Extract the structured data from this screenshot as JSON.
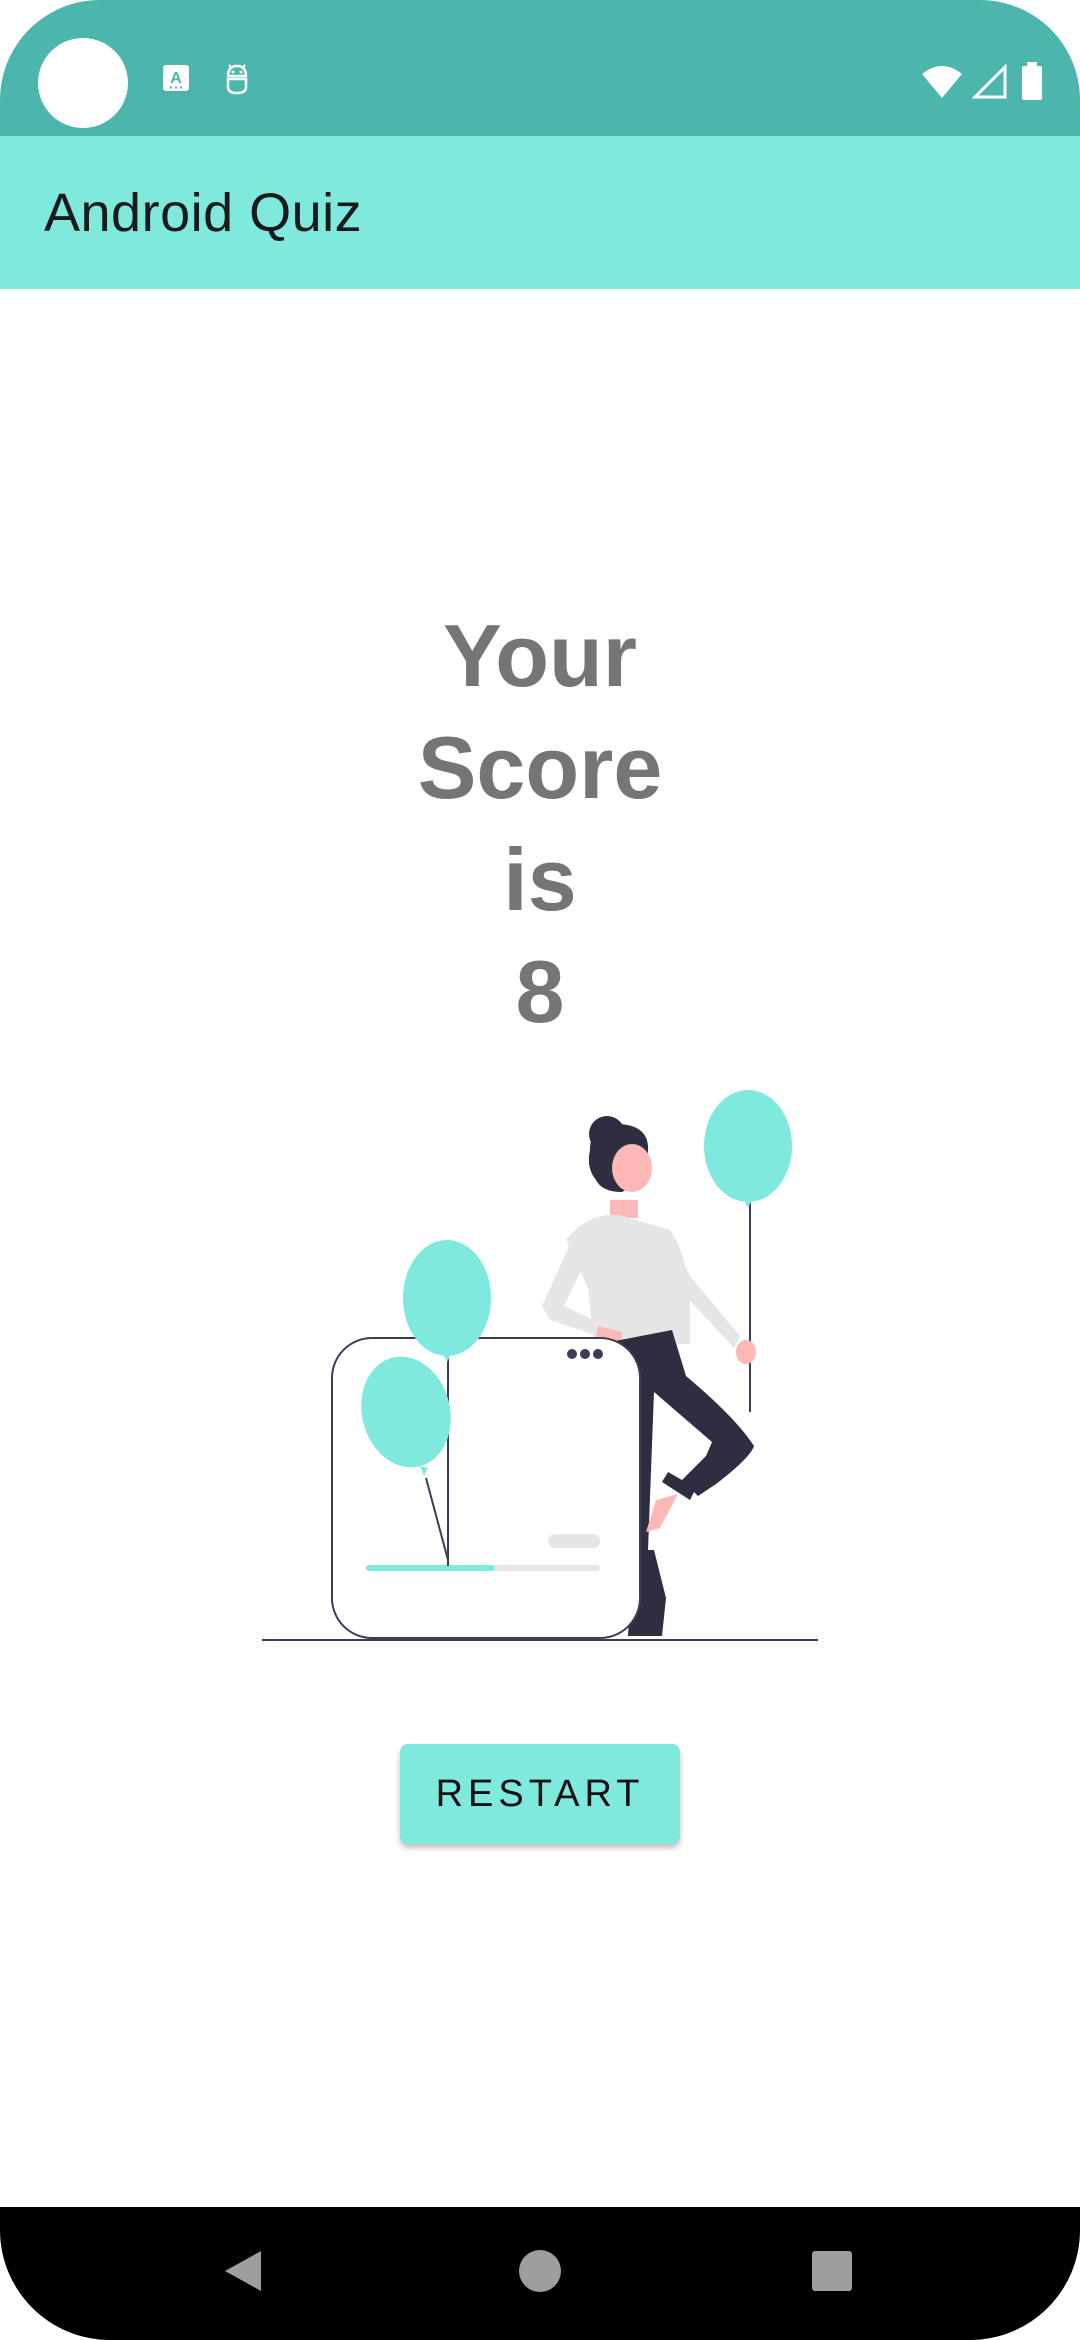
{
  "status_bar": {
    "background_color": "#4db6ac",
    "icons": [
      "camera-cutout",
      "a11y-text-icon",
      "android-debug-icon",
      "wifi-icon",
      "cell-signal-icon",
      "battery-icon"
    ]
  },
  "app_bar": {
    "title": "Android Quiz",
    "background_color": "#80e9de"
  },
  "score": {
    "line1": "Your",
    "line2": "Score",
    "line3": "is",
    "value": "8"
  },
  "illustration": {
    "name": "woman-with-balloons-illustration",
    "accent_color": "#80e9de",
    "progress_fraction": 0.55
  },
  "restart_button": {
    "label": "RESTART"
  },
  "nav_bar": {
    "items": [
      "back-icon",
      "home-icon",
      "recents-icon"
    ]
  }
}
